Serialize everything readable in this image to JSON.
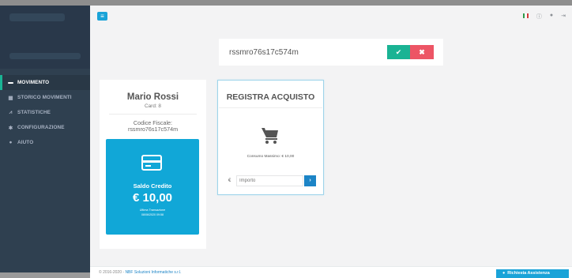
{
  "sidebar": {
    "items": [
      {
        "icon": "cash-icon",
        "label": "MOVIMENTO",
        "active": true
      },
      {
        "icon": "calendar-icon",
        "label": "STORICO MOVIMENTI",
        "active": false
      },
      {
        "icon": "chart-icon",
        "label": "STATISTICHE",
        "active": false
      },
      {
        "icon": "gear-icon",
        "label": "CONFIGURAZIONE",
        "active": false
      },
      {
        "icon": "help-icon",
        "label": "AIUTO",
        "active": false
      }
    ]
  },
  "topbar": {
    "menu_icon": "≡",
    "icons": [
      "italian-flag-icon",
      "info-icon",
      "chat-icon",
      "logout-icon"
    ]
  },
  "search": {
    "value": "rssmro76s17c574m",
    "confirm_icon": "✔",
    "cancel_icon": "✖"
  },
  "user_card": {
    "name": "Mario Rossi",
    "card": "Card: 8",
    "fiscal_code_label": "Codice Fiscale:",
    "fiscal_code": "rssmro76s17c574m",
    "credit_label": "Saldo Credito",
    "credit_amount": "€ 10,00",
    "last_transaction_label": "Ultima Transazione",
    "last_transaction_date": "08/06/2020 09:58"
  },
  "purchase_card": {
    "title": "REGISTRA ACQUISTO",
    "max_consumption": "Consumo Massimo: € 10,00",
    "currency": "€",
    "amount_placeholder": "Importo",
    "submit_icon": "›"
  },
  "footer": {
    "copyright": "© 2016-2020 - ",
    "company": "NBF Soluzioni Informatiche s.r.l.",
    "help_label": "Richiesta Assistenza"
  },
  "colors": {
    "sidebar": "#2f4050",
    "accent_green": "#1ab394",
    "accent_red": "#ed5565",
    "accent_blue": "#1aa3d8"
  }
}
